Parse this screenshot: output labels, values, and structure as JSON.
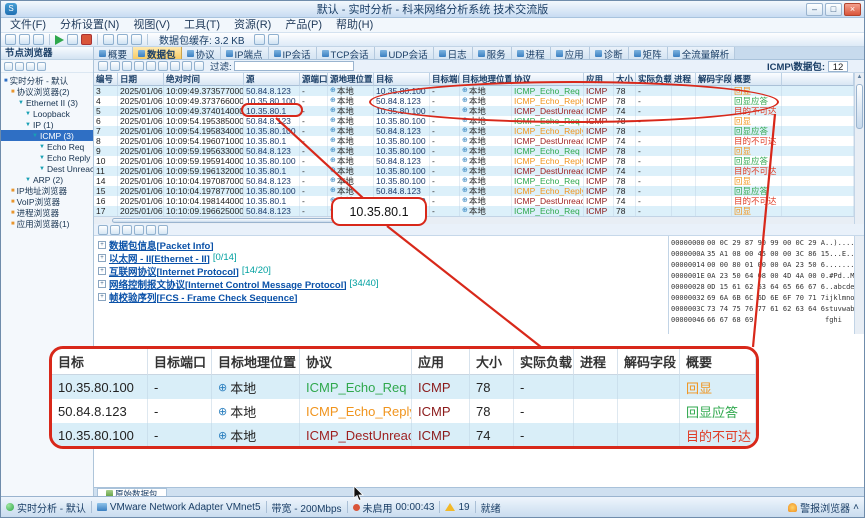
{
  "window": {
    "title": "默认 - 实时分析 - 科来网络分析系统 技术交流版"
  },
  "menu": {
    "items": [
      "文件(F)",
      "分析设置(N)",
      "视图(V)",
      "工具(T)",
      "资源(R)",
      "产品(P)",
      "帮助(H)"
    ]
  },
  "toolbar": {
    "buffer_label": "数据包缓存: 3.2 KB"
  },
  "sidebar": {
    "title": "节点浏览器",
    "tree": [
      {
        "label": "实时分析 - 默认",
        "depth": 0,
        "icon": "monitor",
        "selected": false
      },
      {
        "label": "协议浏览器(2)",
        "depth": 1,
        "icon": "browser",
        "selected": false
      },
      {
        "label": "Ethernet II (3)",
        "depth": 2,
        "icon": "filter",
        "selected": false
      },
      {
        "label": "Loopback",
        "depth": 3,
        "icon": "filter",
        "selected": false
      },
      {
        "label": "IP (1)",
        "depth": 3,
        "icon": "filter",
        "selected": false
      },
      {
        "label": "ICMP (3)",
        "depth": 4,
        "icon": "filter",
        "selected": true
      },
      {
        "label": "Echo Req",
        "depth": 5,
        "icon": "filter",
        "selected": false
      },
      {
        "label": "Echo Reply",
        "depth": 5,
        "icon": "filter",
        "selected": false
      },
      {
        "label": "Dest Unreach",
        "depth": 5,
        "icon": "filter",
        "selected": false
      },
      {
        "label": "ARP (2)",
        "depth": 3,
        "icon": "filter",
        "selected": false
      },
      {
        "label": "IP地址浏览器",
        "depth": 1,
        "icon": "browser",
        "selected": false
      },
      {
        "label": "VoIP浏览器",
        "depth": 1,
        "icon": "browser",
        "selected": false
      },
      {
        "label": "进程浏览器",
        "depth": 1,
        "icon": "browser",
        "selected": false
      },
      {
        "label": "应用浏览器(1)",
        "depth": 1,
        "icon": "browser",
        "selected": false
      }
    ]
  },
  "tabs": {
    "items": [
      "概要",
      "数据包",
      "协议",
      "IP端点",
      "IP会话",
      "TCP会话",
      "UDP会话",
      "日志",
      "服务",
      "进程",
      "应用",
      "诊断",
      "矩阵",
      "全流量解析"
    ],
    "active": "数据包"
  },
  "filterbar": {
    "filter_label": "过滤:",
    "counter_label": "ICMP\\数据包:",
    "counter_value": "12"
  },
  "packet_table": {
    "columns": [
      "编号",
      "日期",
      "绝对时间",
      "源",
      "源端口",
      "源地理位置",
      "目标",
      "目标端口",
      "目标地理位置",
      "协议",
      "应用",
      "大小",
      "实际负载",
      "进程",
      "解码字段",
      "概要"
    ],
    "palette": {
      "req": {
        "proto": "#2fa84d",
        "summary": "#f0941d"
      },
      "reply": {
        "proto": "#f0941d",
        "summary": "#2fa84d"
      },
      "unreach": {
        "proto": "#9e1f1f",
        "summary": "#e03b24"
      },
      "app": "#8b1a1a",
      "ip_text": "#1b3a6b",
      "geo_icon": "#2a7fbf",
      "annotation": "#d8281a"
    },
    "rows": [
      {
        "no": "3",
        "date": "2025/01/06",
        "time": "10:09:49.373577000",
        "src": "50.84.8.123",
        "sport": "-",
        "sgeo": "本地",
        "dst": "10.35.80.100",
        "dport": "-",
        "dgeo": "本地",
        "proto": "ICMP_Echo_Req",
        "app": "ICMP",
        "size": "78",
        "payload": "-",
        "proc": "",
        "decode": "",
        "summary": "回显",
        "kind": "req"
      },
      {
        "no": "4",
        "date": "2025/01/06",
        "time": "10:09:49.373766000",
        "src": "10.35.80.100",
        "sport": "-",
        "sgeo": "本地",
        "dst": "50.84.8.123",
        "dport": "-",
        "dgeo": "本地",
        "proto": "ICMP_Echo_Reply",
        "app": "ICMP",
        "size": "78",
        "payload": "-",
        "proc": "",
        "decode": "",
        "summary": "回显应答",
        "kind": "reply"
      },
      {
        "no": "5",
        "date": "2025/01/06",
        "time": "10:09:49.374014000",
        "src": "10.35.80.1",
        "sport": "-",
        "sgeo": "本地",
        "dst": "10.35.80.100",
        "dport": "-",
        "dgeo": "本地",
        "proto": "ICMP_DestUnreach",
        "app": "ICMP",
        "size": "74",
        "payload": "-",
        "proc": "",
        "decode": "",
        "summary": "目的不可达",
        "kind": "unreach"
      },
      {
        "no": "6",
        "date": "2025/01/06",
        "time": "10:09:54.195385000",
        "src": "50.84.8.123",
        "sport": "-",
        "sgeo": "本地",
        "dst": "10.35.80.100",
        "dport": "-",
        "dgeo": "本地",
        "proto": "ICMP_Echo_Req",
        "app": "ICMP",
        "size": "78",
        "payload": "-",
        "proc": "",
        "decode": "",
        "summary": "回显",
        "kind": "req"
      },
      {
        "no": "7",
        "date": "2025/01/06",
        "time": "10:09:54.195834000",
        "src": "10.35.80.100",
        "sport": "-",
        "sgeo": "本地",
        "dst": "50.84.8.123",
        "dport": "-",
        "dgeo": "本地",
        "proto": "ICMP_Echo_Reply",
        "app": "ICMP",
        "size": "78",
        "payload": "-",
        "proc": "",
        "decode": "",
        "summary": "回显应答",
        "kind": "reply"
      },
      {
        "no": "8",
        "date": "2025/01/06",
        "time": "10:09:54.196071000",
        "src": "10.35.80.1",
        "sport": "-",
        "sgeo": "本地",
        "dst": "10.35.80.100",
        "dport": "-",
        "dgeo": "本地",
        "proto": "ICMP_DestUnreach",
        "app": "ICMP",
        "size": "74",
        "payload": "-",
        "proc": "",
        "decode": "",
        "summary": "目的不可达",
        "kind": "unreach"
      },
      {
        "no": "9",
        "date": "2025/01/06",
        "time": "10:09:59.195633000",
        "src": "50.84.8.123",
        "sport": "-",
        "sgeo": "本地",
        "dst": "10.35.80.100",
        "dport": "-",
        "dgeo": "本地",
        "proto": "ICMP_Echo_Req",
        "app": "ICMP",
        "size": "78",
        "payload": "-",
        "proc": "",
        "decode": "",
        "summary": "回显",
        "kind": "req"
      },
      {
        "no": "10",
        "date": "2025/01/06",
        "time": "10:09:59.195914000",
        "src": "10.35.80.100",
        "sport": "-",
        "sgeo": "本地",
        "dst": "50.84.8.123",
        "dport": "-",
        "dgeo": "本地",
        "proto": "ICMP_Echo_Reply",
        "app": "ICMP",
        "size": "78",
        "payload": "-",
        "proc": "",
        "decode": "",
        "summary": "回显应答",
        "kind": "reply"
      },
      {
        "no": "11",
        "date": "2025/01/06",
        "time": "10:09:59.196132000",
        "src": "10.35.80.1",
        "sport": "-",
        "sgeo": "本地",
        "dst": "10.35.80.100",
        "dport": "-",
        "dgeo": "本地",
        "proto": "ICMP_DestUnreach",
        "app": "ICMP",
        "size": "74",
        "payload": "-",
        "proc": "",
        "decode": "",
        "summary": "目的不可达",
        "kind": "unreach"
      },
      {
        "no": "14",
        "date": "2025/01/06",
        "time": "10:10:04.197087000",
        "src": "50.84.8.123",
        "sport": "-",
        "sgeo": "本地",
        "dst": "10.35.80.100",
        "dport": "-",
        "dgeo": "本地",
        "proto": "ICMP_Echo_Req",
        "app": "ICMP",
        "size": "78",
        "payload": "-",
        "proc": "",
        "decode": "",
        "summary": "回显",
        "kind": "req"
      },
      {
        "no": "15",
        "date": "2025/01/06",
        "time": "10:10:04.197877000",
        "src": "10.35.80.100",
        "sport": "-",
        "sgeo": "本地",
        "dst": "50.84.8.123",
        "dport": "-",
        "dgeo": "本地",
        "proto": "ICMP_Echo_Reply",
        "app": "ICMP",
        "size": "78",
        "payload": "-",
        "proc": "",
        "decode": "",
        "summary": "回显应答",
        "kind": "reply"
      },
      {
        "no": "16",
        "date": "2025/01/06",
        "time": "10:10:04.198144000",
        "src": "10.35.80.1",
        "sport": "-",
        "sgeo": "本地",
        "dst": "10.35.80.100",
        "dport": "-",
        "dgeo": "本地",
        "proto": "ICMP_DestUnreach",
        "app": "ICMP",
        "size": "74",
        "payload": "-",
        "proc": "",
        "decode": "",
        "summary": "目的不可达",
        "kind": "unreach"
      },
      {
        "no": "17",
        "date": "2025/01/06",
        "time": "10:10:09.196625000",
        "src": "50.84.8.123",
        "sport": "-",
        "sgeo": "本地",
        "dst": "10.35.80.100",
        "dport": "-",
        "dgeo": "本地",
        "proto": "ICMP_Echo_Req",
        "app": "ICMP",
        "size": "78",
        "payload": "-",
        "proc": "",
        "decode": "",
        "summary": "回显",
        "kind": "req"
      }
    ]
  },
  "decode": {
    "items": [
      {
        "label": "数据包信息[Packet Info]",
        "range": ""
      },
      {
        "label": "以太网 - II[Ethernet - II]",
        "range": "[0/14]"
      },
      {
        "label": "互联网协议[Internet Protocol]",
        "range": "[14/20]"
      },
      {
        "label": "网络控制报文协议[Internet Control Message Protocol]",
        "range": "[34/40]"
      },
      {
        "label": "帧校验序列[FCS - Frame Check Sequence]",
        "range": ""
      }
    ]
  },
  "hex": {
    "lines": [
      {
        "offset": "00000000",
        "bytes": "00 0C 29 87 90 99 00 0C 29 A7",
        "ascii": "..)......)"
      },
      {
        "offset": "0000000A",
        "bytes": "35 A1 08 00 45 00 00 3C 86 11",
        "ascii": "5...E..<.."
      },
      {
        "offset": "00000014",
        "bytes": "00 00 80 01 00 00 0A 23 50 64",
        "ascii": ".......#Pd"
      },
      {
        "offset": "0000001E",
        "bytes": "0A 23 50 64 08 00 4D 4A 00 01",
        "ascii": ".#Pd..MJ.."
      },
      {
        "offset": "00000028",
        "bytes": "0D 15 61 62 63 64 65 66 67 68",
        "ascii": "..abcdefgh"
      },
      {
        "offset": "00000032",
        "bytes": "69 6A 6B 6C 6D 6E 6F 70 71 72",
        "ascii": "ijklmnopqr"
      },
      {
        "offset": "0000003C",
        "bytes": "73 74 75 76 77 61 62 63 64 65",
        "ascii": "stuvwabcde"
      },
      {
        "offset": "00000046",
        "bytes": "66 67 68 69",
        "ascii": "fghi"
      }
    ]
  },
  "bottom": {
    "tab_label": "原始数据包"
  },
  "annotations": {
    "color": "#d8281a",
    "callout_text": "10.35.80.1",
    "zoom_table": {
      "columns": [
        "目标",
        "目标端口",
        "目标地理位置",
        "协议",
        "应用",
        "大小",
        "实际负载",
        "进程",
        "解码字段",
        "概要"
      ],
      "rows": [
        {
          "dst": "10.35.80.100",
          "dport": "-",
          "dgeo": "本地",
          "proto": "ICMP_Echo_Req",
          "app": "ICMP",
          "size": "78",
          "payload": "-",
          "proc": "",
          "decode": "",
          "summary": "回显",
          "kind": "req"
        },
        {
          "dst": "50.84.8.123",
          "dport": "-",
          "dgeo": "本地",
          "proto": "ICMP_Echo_Reply",
          "app": "ICMP",
          "size": "78",
          "payload": "-",
          "proc": "",
          "decode": "",
          "summary": "回显应答",
          "kind": "reply"
        },
        {
          "dst": "10.35.80.100",
          "dport": "-",
          "dgeo": "本地",
          "proto": "ICMP_DestUnreach",
          "app": "ICMP",
          "size": "74",
          "payload": "-",
          "proc": "",
          "decode": "",
          "summary": "目的不可达",
          "kind": "unreach"
        }
      ]
    }
  },
  "statusbar": {
    "analysis": "实时分析 - 默认",
    "adapter": "VMware Network Adapter VMnet5",
    "bandwidth": "带宽 - 200Mbps",
    "capture_state": "未启用",
    "duration": "00:00:43",
    "alert_count": "19",
    "ready": "就绪",
    "alarm_label": "警报浏览器"
  }
}
